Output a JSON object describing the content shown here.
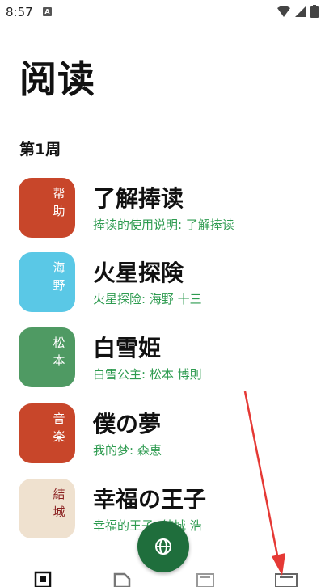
{
  "status_bar": {
    "time": "8:57",
    "notification_letter": "A"
  },
  "page": {
    "title": "阅读",
    "week_label": "第1周"
  },
  "books": [
    {
      "cover_text": "帮助",
      "cover_color": "#c8462a",
      "cover_text_color": "#ffffff",
      "title": "了解捧读",
      "subtitle": "捧读的使用说明: 了解捧读"
    },
    {
      "cover_text": "海野",
      "cover_color": "#5ac8e6",
      "cover_text_color": "#ffffff",
      "title": "火星探険",
      "subtitle": "火星探险: 海野 十三"
    },
    {
      "cover_text": "松本",
      "cover_color": "#4f9a63",
      "cover_text_color": "#ffffff",
      "title": "白雪姫",
      "subtitle": "白雪公主: 松本 博則"
    },
    {
      "cover_text": "音楽",
      "cover_color": "#c8462a",
      "cover_text_color": "#ffffff",
      "title": "僕の夢",
      "subtitle": "我的梦: 森恵"
    },
    {
      "cover_text": "結城",
      "cover_color": "#efe1cf",
      "cover_text_color": "#8a1f1f",
      "title": "幸福の王子",
      "subtitle": "幸福的王子: 結城 浩"
    }
  ],
  "bottom_nav": {
    "items": [
      {
        "icon": "book-icon"
      },
      {
        "icon": "document-icon"
      },
      {
        "icon": "globe-icon"
      },
      {
        "icon": "list-icon"
      },
      {
        "icon": "profile-icon"
      }
    ],
    "accent_color": "#1f6e3c",
    "subtitle_color": "#2e9b50"
  }
}
